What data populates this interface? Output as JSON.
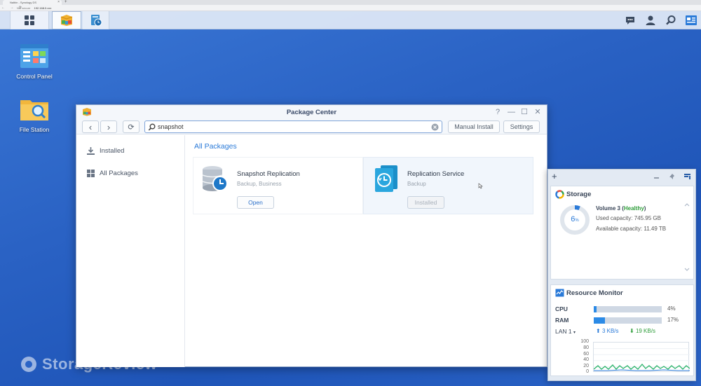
{
  "browser": {
    "tab_title": "Nalbin - Synology DS",
    "tab_close": "×",
    "new_tab": "+",
    "nav": "← → ⟳",
    "insecure_label": "Not secure",
    "url_host": "192.168.0.xxx"
  },
  "taskbar": {
    "main_menu_icon": "grid-icon",
    "open_apps": [
      "package-center-icon",
      "replication-service-icon"
    ],
    "right_icons": [
      "chat-icon",
      "user-icon",
      "search-icon",
      "widgets-icon"
    ]
  },
  "desktop": {
    "icons": [
      {
        "label": "Control Panel"
      },
      {
        "label": "File Station"
      }
    ]
  },
  "watermark": "StorageReview",
  "package_center": {
    "title": "Package Center",
    "controls": [
      "?",
      "—",
      "☐",
      "✕"
    ],
    "toolbar": {
      "back": "‹",
      "forward": "›",
      "refresh": "⟳",
      "search_value": "snapshot",
      "manual_install": "Manual Install",
      "settings": "Settings"
    },
    "sidebar": [
      {
        "label": "Installed"
      },
      {
        "label": "All Packages"
      }
    ],
    "section_title": "All Packages",
    "packages": [
      {
        "name": "Snapshot Replication",
        "category": "Backup, Business",
        "action": "Open"
      },
      {
        "name": "Replication Service",
        "category": "Backup",
        "action": "Installed"
      }
    ]
  },
  "widgets": {
    "add": "+",
    "storage": {
      "title": "Storage",
      "percent": "6",
      "percent_unit": "%",
      "used_fraction": 0.06,
      "volume_name": "Volume 3",
      "status": "Healthy",
      "used": "Used capacity: 745.95 GB",
      "available": "Available capacity: 11.49 TB"
    },
    "resource_monitor": {
      "title": "Resource Monitor",
      "cpu_label": "CPU",
      "cpu_pct": "4%",
      "cpu_value": 4,
      "ram_label": "RAM",
      "ram_pct": "17%",
      "ram_value": 17,
      "lan_label": "LAN 1",
      "lan_up": "3 KB/s",
      "lan_down": "19 KB/s",
      "y_ticks": [
        "100",
        "80",
        "60",
        "40",
        "20",
        "0"
      ]
    },
    "colors": {
      "accent": "#2a7ad8",
      "healthy": "#2e9d3a",
      "bar": "#2b8ae6",
      "chart_line": "#29b36a"
    }
  }
}
